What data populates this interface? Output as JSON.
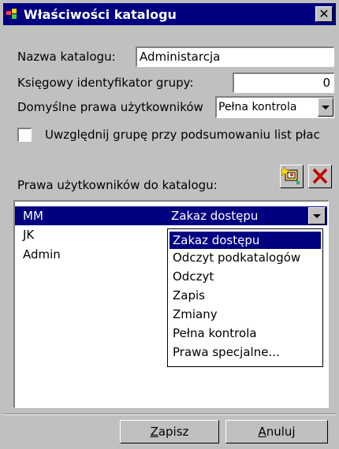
{
  "window": {
    "title": "Właściwości katalogu",
    "close_label": "✕"
  },
  "form": {
    "catalog_name_label": "Nazwa katalogu:",
    "catalog_name_value": "Administarcja",
    "account_id_label": "Księgowy identyfikator grupy:",
    "account_id_value": "0",
    "default_rights_label": "Domyślne prawa użytkowników",
    "default_rights_value": "Pełna kontrola",
    "include_group_label": "Uwzględnij grupę przy podsumowaniu list płac",
    "include_group_checked": false
  },
  "permissions": {
    "section_label": "Prawa użytkowników do katalogu:",
    "add_icon": "add-user-icon",
    "delete_icon": "delete-x-icon",
    "rows": [
      {
        "user": "MM",
        "permission": "Zakaz dostępu",
        "selected": true
      },
      {
        "user": "JK",
        "permission": "",
        "selected": false
      },
      {
        "user": "Admin",
        "permission": "",
        "selected": false
      }
    ],
    "dropdown_options": [
      "Zakaz dostępu",
      "Odczyt podkatalogów",
      "Odczyt",
      "Zapis",
      "Zmiany",
      "Pełna kontrola",
      "Prawa specjalne..."
    ],
    "dropdown_selected": "Zakaz dostępu"
  },
  "buttons": {
    "save_mnemonic": "Z",
    "save_rest": "apisz",
    "cancel_mnemonic": "A",
    "cancel_rest": "nuluj"
  },
  "colors": {
    "titlebar": "#000080",
    "selection": "#000080",
    "face": "#c0c0c0"
  }
}
